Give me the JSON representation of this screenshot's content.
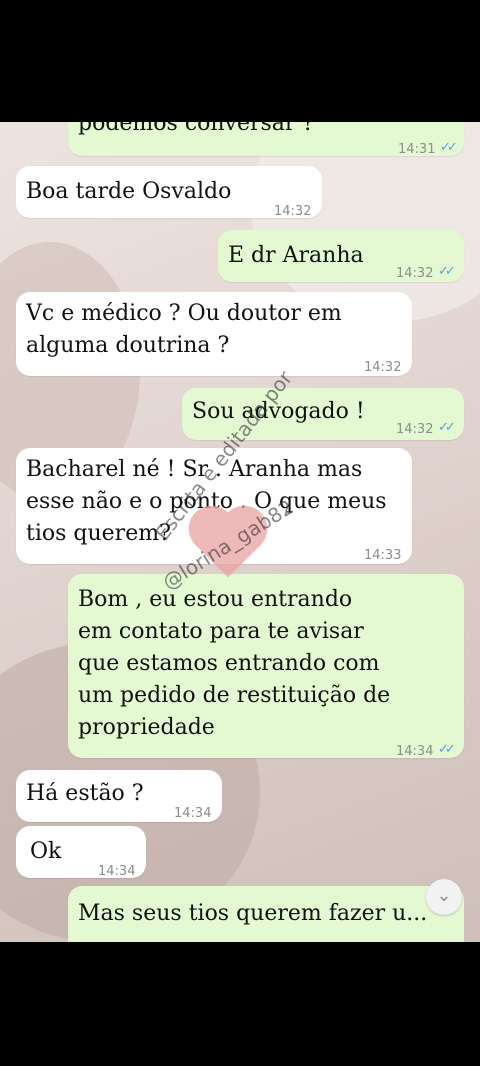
{
  "messages": [
    {
      "id": "m1",
      "dir": "out",
      "lines": [
        "podemos conversar ?"
      ],
      "time": "14:31",
      "ticks": "✓✓"
    },
    {
      "id": "m2",
      "dir": "in",
      "lines": [
        "Boa tarde Osvaldo"
      ],
      "time": "14:32"
    },
    {
      "id": "m3",
      "dir": "out",
      "lines": [
        "E dr Aranha"
      ],
      "time": "14:32",
      "ticks": "✓✓"
    },
    {
      "id": "m4",
      "dir": "in",
      "lines": [
        "Vc e médico ? Ou doutor em",
        "alguma doutrina ?"
      ],
      "time": "14:32"
    },
    {
      "id": "m5",
      "dir": "out",
      "lines": [
        "Sou advogado !"
      ],
      "time": "14:32",
      "ticks": "✓✓"
    },
    {
      "id": "m6",
      "dir": "in",
      "lines": [
        "Bacharel né ! Sr . Aranha mas",
        "esse não e o ponto . O que meus",
        "tios querem?"
      ],
      "time": "14:33"
    },
    {
      "id": "m7",
      "dir": "out",
      "lines": [
        "Bom , eu estou entrando",
        "em contato para te avisar",
        "que estamos entrando com",
        "um pedido de restituição de",
        "propriedade"
      ],
      "time": "14:34",
      "ticks": "✓✓"
    },
    {
      "id": "m8",
      "dir": "in",
      "lines": [
        "Há estão ?"
      ],
      "time": "14:34"
    },
    {
      "id": "m9",
      "dir": "in",
      "lines": [
        "Ok"
      ],
      "time": "14:34"
    },
    {
      "id": "m10",
      "dir": "out",
      "lines": [
        "Mas seus tios querem fazer u..."
      ]
    }
  ],
  "watermark": {
    "line1": "Escrita e editada por",
    "line2": "@lorina_gab82"
  },
  "icons": {
    "read_ticks": "double-check-icon",
    "scroll_down": "chevron-down-icon",
    "sticker": "heart-icon"
  },
  "colors": {
    "incoming": "#ffffff",
    "outgoing": "#e4f8d2",
    "ticks": "#4fa6e0"
  },
  "scroll_button_glyph": "⌄"
}
